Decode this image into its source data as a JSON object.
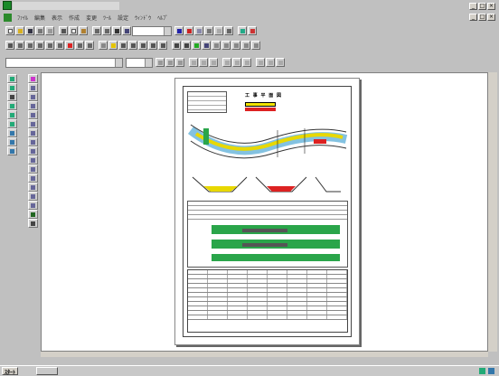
{
  "titlebar": {
    "title": "",
    "window_buttons": [
      "_",
      "□",
      "×"
    ]
  },
  "menubar": {
    "items": [
      "ﾌｧｲﾙ",
      "編集",
      "表示",
      "作成",
      "変更",
      "ﾂｰﾙ",
      "設定",
      "ｳｨﾝﾄﾞｳ",
      "ﾍﾙﾌﾟ"
    ],
    "mdi_buttons": [
      "_",
      "□",
      "×"
    ]
  },
  "toolbar": {
    "zoom_combo_value": "",
    "style_combo_value": ""
  },
  "document": {
    "title": "工 事 平 面 図",
    "corner_note": "",
    "footer_note": ""
  },
  "statusbar": {
    "message": "",
    "right_value": ""
  },
  "taskbar": {
    "start_label": "ｽﾀｰﾄ",
    "task_label": "",
    "clock": ""
  },
  "colors": {
    "accent_green": "#1a8a2a",
    "highlight_yellow": "#f2e500",
    "alert_red": "#d22",
    "chart_green": "#2aa54a"
  }
}
